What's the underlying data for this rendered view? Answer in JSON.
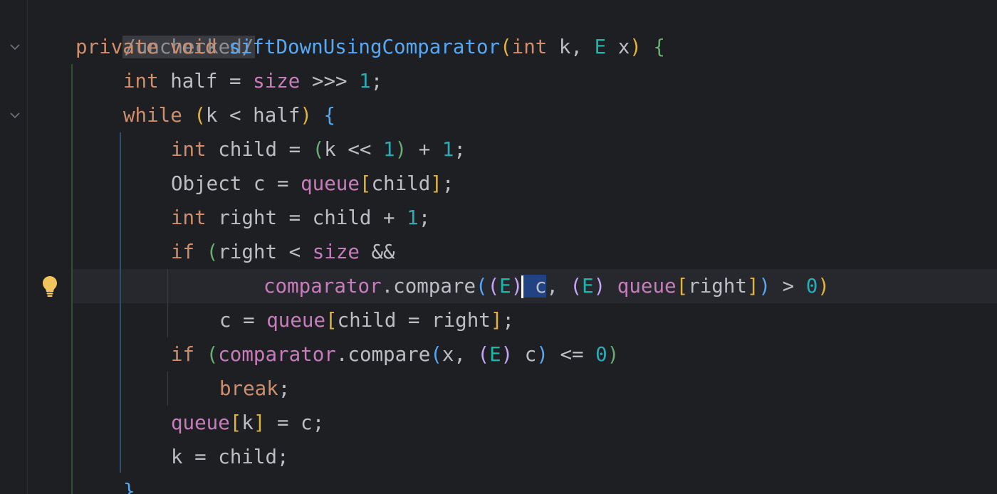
{
  "editor": {
    "annotation": "/unchecked/",
    "lines": {
      "l1": {
        "kw_private": "private",
        "kw_void": "void",
        "method": "siftDownUsingComparator",
        "p_open": "(",
        "kw_int": "int",
        "param_k": "k,",
        "type_E": "E",
        "param_x": "x",
        "p_close": ")",
        "brace": "{"
      },
      "l2": {
        "kw_int": "int",
        "text1": "half = ",
        "field_size": "size",
        "text2": " >>> ",
        "num": "1",
        "semi": ";"
      },
      "l3": {
        "kw_while": "while",
        "p_open": "(",
        "cond": "k < half",
        "p_close": ")",
        "brace": "{"
      },
      "l4": {
        "kw_int": "int",
        "text1": "child = ",
        "p_open": "(",
        "text2": "k << ",
        "num1": "1",
        "p_close": ")",
        "text3": " + ",
        "num2": "1",
        "semi": ";"
      },
      "l5": {
        "text1": "Object c = ",
        "field_queue": "queue",
        "b_open": "[",
        "idx": "child",
        "b_close": "]",
        "semi": ";"
      },
      "l6": {
        "kw_int": "int",
        "text1": "right = child + ",
        "num": "1",
        "semi": ";"
      },
      "l7": {
        "kw_if": "if",
        "p_open": "(",
        "text1": "right < ",
        "field_size": "size",
        "text2": " &&"
      },
      "l8": {
        "field_comparator": "comparator",
        "method": ".compare",
        "p_open": "(",
        "cast_open": "(",
        "type_E1": "E",
        "cast_close": ")",
        "var_c": "c",
        "comma": ", ",
        "cast2_open": "(",
        "type_E2": "E",
        "cast2_close": ")",
        "field_queue": "queue",
        "b_open": "[",
        "idx": "right",
        "b_close": "]",
        "p_close": ")",
        "text1": " > ",
        "num": "0",
        "if_close": ")"
      },
      "l9": {
        "text1": "c = ",
        "field_queue": "queue",
        "b_open": "[",
        "idx": "child = right",
        "b_close": "]",
        "semi": ";"
      },
      "l10": {
        "kw_if": "if",
        "p_open": "(",
        "field_comparator": "comparator",
        "method": ".compare",
        "p2_open": "(",
        "arg1": "x, ",
        "cast_open": "(",
        "type_E": "E",
        "cast_close": ")",
        "arg2": " c",
        "p2_close": ")",
        "text1": " <= ",
        "num": "0",
        "p_close": ")"
      },
      "l11": {
        "kw_break": "break",
        "semi": ";"
      },
      "l12": {
        "field_queue": "queue",
        "b_open": "[",
        "idx": "k",
        "b_close": "]",
        "text1": " = c;"
      },
      "l13": {
        "text1": "k = child;"
      },
      "l14": {
        "brace": "}"
      }
    }
  },
  "colors": {
    "background": "#1e1f22",
    "current_line": "#26282e",
    "keyword": "#cf8e6d",
    "method": "#56a8f5",
    "number": "#2aacb8",
    "field": "#c77dbb",
    "type_param": "#16baac",
    "selection": "#214283"
  }
}
